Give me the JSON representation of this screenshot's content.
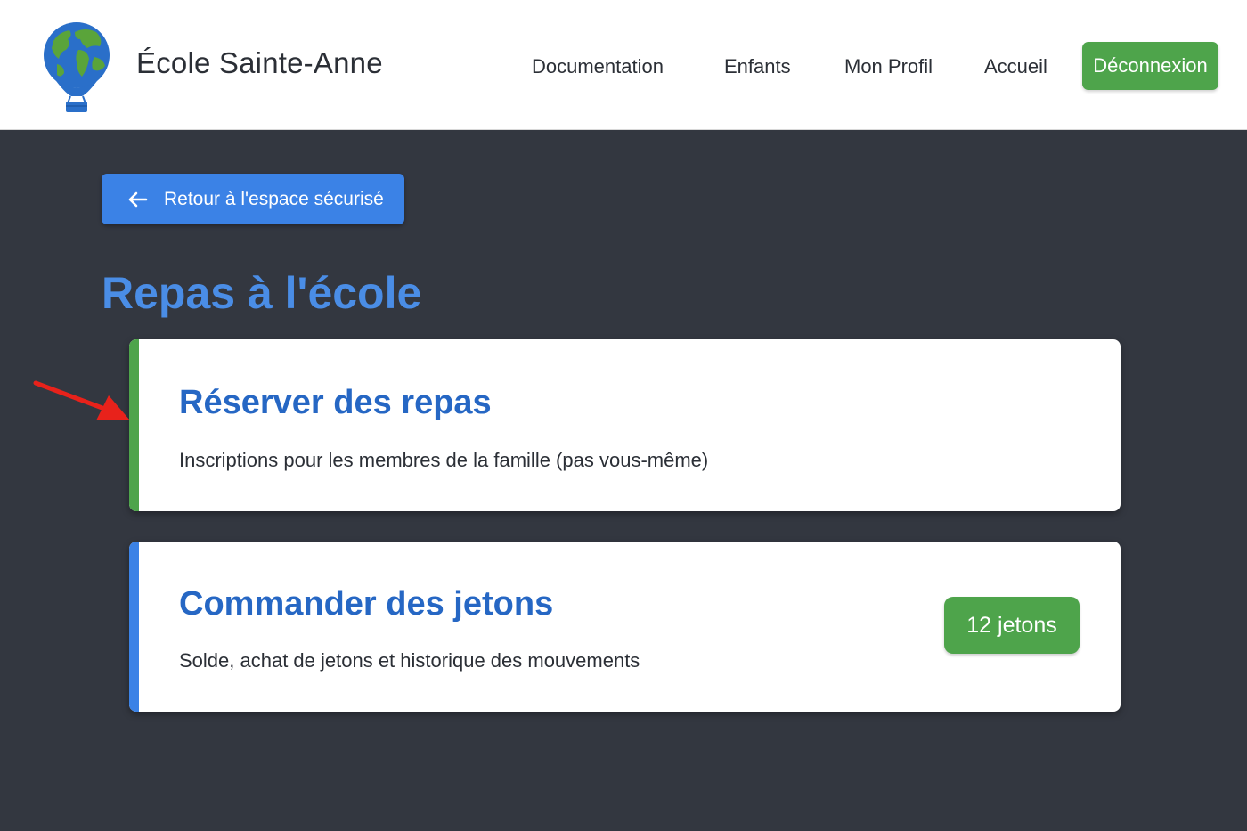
{
  "header": {
    "brand": "École Sainte-Anne",
    "logo_icon": "hot-air-balloon-globe-icon",
    "nav": [
      {
        "label": "Documentation"
      },
      {
        "label": "Enfants"
      },
      {
        "label": "Mon Profil"
      },
      {
        "label": "Accueil"
      }
    ],
    "logout_label": "Déconnexion"
  },
  "back_button": {
    "label": "Retour à l'espace sécurisé",
    "icon": "arrow-left-icon"
  },
  "page_title": "Repas à l'école",
  "cards": [
    {
      "title": "Réserver des repas",
      "description": "Inscriptions pour les membres de la famille (pas vous-même)",
      "accent_color": "#4ea44b"
    },
    {
      "title": "Commander des jetons",
      "description": "Solde, achat de jetons et historique des mouvements",
      "accent_color": "#3b82e6",
      "badge": "12 jetons"
    }
  ],
  "annotation": {
    "icon": "red-arrow-pointer-icon",
    "color": "#e8221b"
  },
  "colors": {
    "background": "#333740",
    "primary_blue": "#3b82e6",
    "title_blue": "#4a8de6",
    "card_title_blue": "#2667c4",
    "success_green": "#4ea44b"
  }
}
